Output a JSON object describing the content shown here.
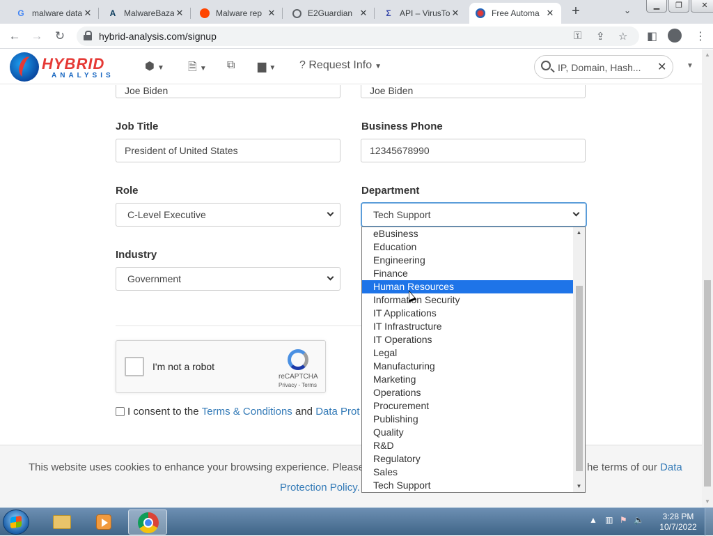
{
  "browser": {
    "tabs": [
      {
        "title": "malware data",
        "favicon": "G"
      },
      {
        "title": "MalwareBaza",
        "favicon": "A"
      },
      {
        "title": "Malware rep",
        "favicon": "reddit"
      },
      {
        "title": "E2Guardian",
        "favicon": "globe"
      },
      {
        "title": "API – VirusTo",
        "favicon": "Σ"
      },
      {
        "title": "Free Automa",
        "favicon": "ha"
      }
    ],
    "url": "hybrid-analysis.com/signup"
  },
  "site": {
    "logo_top": "HYBRID",
    "logo_bottom": "ANALYSIS",
    "nav_request_info": "Request Info",
    "search_placeholder": "IP, Domain, Hash..."
  },
  "form": {
    "first_name_value": "Joe Biden",
    "last_name_value": "Joe Biden",
    "job_title_label": "Job Title",
    "job_title_value": "President of United States",
    "phone_label": "Business Phone",
    "phone_value": "12345678990",
    "role_label": "Role",
    "role_value": "C-Level Executive",
    "department_label": "Department",
    "department_value": "Tech Support",
    "industry_label": "Industry",
    "industry_value": "Government",
    "captcha_text": "I'm not a robot",
    "captcha_brand": "reCAPTCHA",
    "captcha_terms": "Privacy - Terms",
    "consent_prefix": "I consent to the ",
    "consent_terms": "Terms & Conditions",
    "consent_and": " and ",
    "consent_data": "Data Prot"
  },
  "department_options": [
    "eBusiness",
    "Education",
    "Engineering",
    "Finance",
    "Human Resources",
    "Information Security",
    "IT Applications",
    "IT Infrastructure",
    "IT Operations",
    "Legal",
    "Manufacturing",
    "Marketing",
    "Operations",
    "Procurement",
    "Publishing",
    "Quality",
    "R&D",
    "Regulatory",
    "Sales",
    "Tech Support"
  ],
  "highlighted_option": "Human Resources",
  "cookie": {
    "line1": "This website uses cookies to enhance your browsing experience. Please note",
    "line1_end": "he terms of our ",
    "link1": "Data",
    "line2": "Protection Policy."
  },
  "taskbar": {
    "time": "3:28 PM",
    "date": "10/7/2022"
  },
  "colors": {
    "link": "#337ab7",
    "highlight": "#1e74e8"
  }
}
